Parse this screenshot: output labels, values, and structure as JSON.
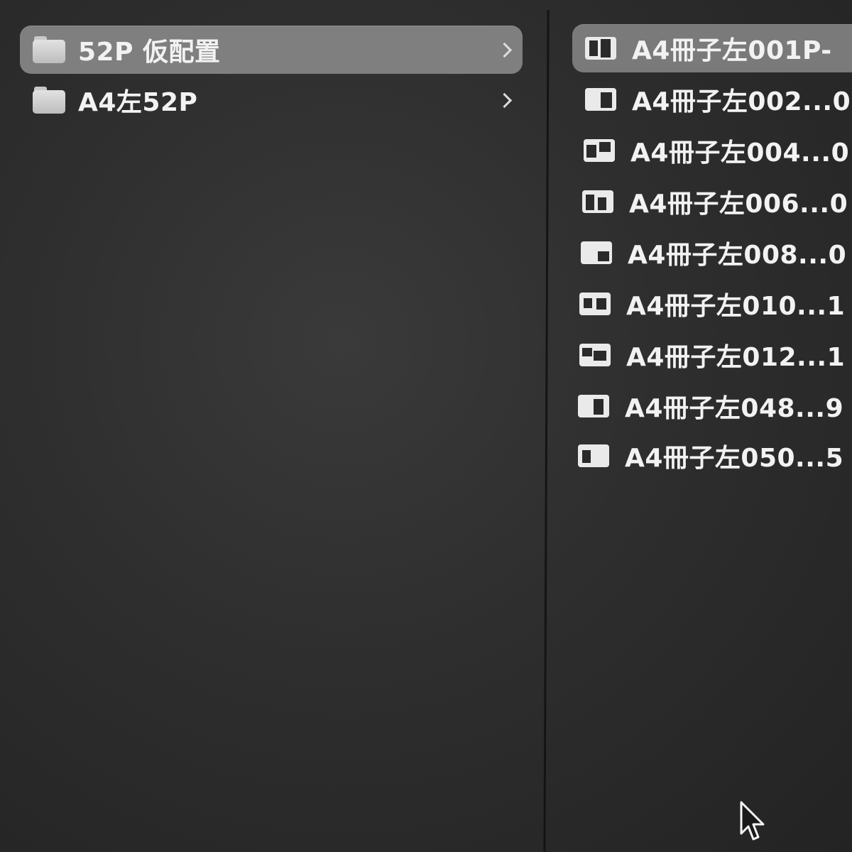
{
  "left_column": {
    "folders": [
      {
        "label": "52P 仮配置",
        "icon": "folder-icon",
        "selected": true
      },
      {
        "label": "A4左52P",
        "icon": "folder-icon",
        "selected": false
      }
    ]
  },
  "right_column": {
    "files": [
      {
        "label": "A4冊子左001P-",
        "icon": "image-thumbnail-icon",
        "selected": true
      },
      {
        "label": "A4冊子左002...0",
        "icon": "image-thumbnail-icon",
        "selected": false
      },
      {
        "label": "A4冊子左004...0",
        "icon": "image-thumbnail-icon",
        "selected": false
      },
      {
        "label": "A4冊子左006...0",
        "icon": "image-thumbnail-icon",
        "selected": false
      },
      {
        "label": "A4冊子左008...0",
        "icon": "image-thumbnail-icon",
        "selected": false
      },
      {
        "label": "A4冊子左010...1",
        "icon": "image-thumbnail-icon",
        "selected": false
      },
      {
        "label": "A4冊子左012...1",
        "icon": "image-thumbnail-icon",
        "selected": false
      },
      {
        "label": "A4冊子左048...9",
        "icon": "image-thumbnail-icon",
        "selected": false
      },
      {
        "label": "A4冊子左050...5",
        "icon": "image-thumbnail-icon",
        "selected": false
      }
    ]
  },
  "colors": {
    "background": "#2e2e2e",
    "selection": "#7f7f7f",
    "text": "#f2f2f2",
    "divider": "#141414"
  }
}
